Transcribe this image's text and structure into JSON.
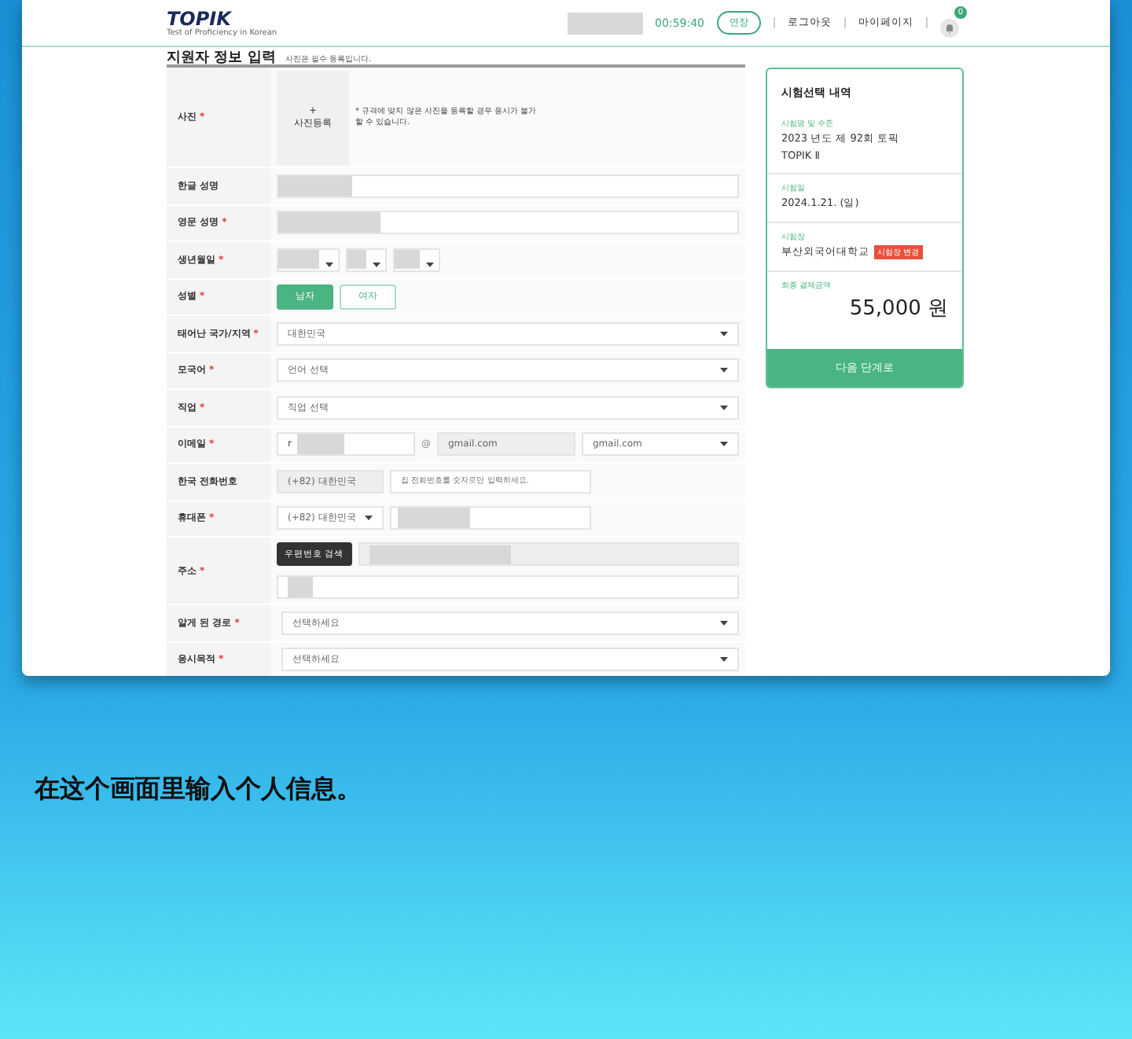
{
  "header": {
    "logo": "TOPIK",
    "logo_sub": "Test of Proficiency in Korean",
    "timer": "00:59:40",
    "extend_button": "연장",
    "links": [
      "로그아웃",
      "마이페이지"
    ],
    "notification_count": "0"
  },
  "required_mark": "*",
  "page_title": "지원자 정보 입력",
  "page_note": "사진은 필수 등록입니다.",
  "form": [
    {
      "kind": "photo",
      "label": "사진",
      "required": true,
      "button_plus": "+",
      "button": "사진등록",
      "note": "* 규격에 맞지 않은 사진을 등록할 경우 응시가 불가할 수 있습니다."
    },
    {
      "kind": "text",
      "label": "한글 성명",
      "required": false
    },
    {
      "kind": "text",
      "label": "영문 성명",
      "required": true
    },
    {
      "kind": "date",
      "label": "생년월일",
      "required": true
    },
    {
      "kind": "gender",
      "label": "성별",
      "required": true,
      "options": [
        {
          "label": "남자",
          "selected": true
        },
        {
          "label": "여자",
          "selected": false
        }
      ]
    },
    {
      "kind": "select",
      "label": "태어난 국가/지역",
      "required": true,
      "value": "대한민국"
    },
    {
      "kind": "select",
      "label": "모국어",
      "required": true,
      "value": "언어 선택"
    },
    {
      "kind": "select",
      "label": "직업",
      "required": true,
      "value": "직업 선택"
    },
    {
      "kind": "email",
      "label": "이메일",
      "required": true,
      "local_first": "r",
      "at": "@",
      "domain": "gmail.com",
      "domain_select": "gmail.com"
    },
    {
      "kind": "phone_fixed",
      "label": "한국 전화번호",
      "required": false,
      "country": "(+82) 대한민국",
      "placeholder": "집 전화번호를 숫자로만 입력하세요."
    },
    {
      "kind": "phone_mobile",
      "label": "휴대폰",
      "required": true,
      "country": "(+82) 대한민국"
    },
    {
      "kind": "address",
      "label": "주소",
      "required": true,
      "button": "우편번호 검색"
    },
    {
      "kind": "select",
      "label": "알게 된 경로",
      "required": true,
      "value": "선택하세요"
    },
    {
      "kind": "select",
      "label": "응시목적",
      "required": true,
      "value": "선택하세요"
    }
  ],
  "summary": {
    "title": "시험선택 내역",
    "sections": [
      {
        "label": "시험명 및 수준",
        "lines": [
          "2023 년도 제 92회 토픽",
          "TOPIK Ⅱ"
        ]
      },
      {
        "label": "시험일",
        "lines": [
          "2024.1.21. (일)"
        ]
      },
      {
        "label": "시험장",
        "lines": [
          "부산외국어대학교"
        ],
        "tag": "시험장 변경"
      }
    ],
    "total_label": "최종 결제금액",
    "total": "55,000 원",
    "next_button": "다음 단계로"
  },
  "caption": "在这个画面里输入个人信息。"
}
